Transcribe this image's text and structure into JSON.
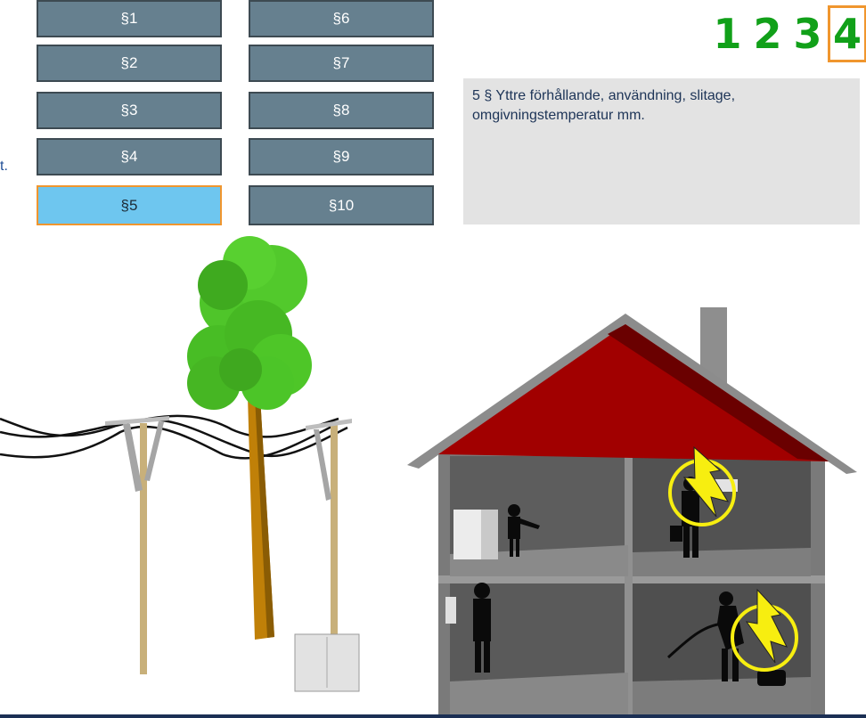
{
  "paragraph_buttons": [
    {
      "label": "§1",
      "active": false
    },
    {
      "label": "§2",
      "active": false
    },
    {
      "label": "§3",
      "active": false
    },
    {
      "label": "§4",
      "active": false
    },
    {
      "label": "§5",
      "active": true
    },
    {
      "label": "§6",
      "active": false
    },
    {
      "label": "§7",
      "active": false
    },
    {
      "label": "§8",
      "active": false
    },
    {
      "label": "§9",
      "active": false
    },
    {
      "label": "§10",
      "active": false
    }
  ],
  "left_fragment": "t.",
  "steps": [
    {
      "label": "1",
      "current": false
    },
    {
      "label": "2",
      "current": false
    },
    {
      "label": "3",
      "current": false
    },
    {
      "label": "4",
      "current": true
    }
  ],
  "description": "5 § Yttre förhållande, användning, slitage, omgivningstemperatur mm.",
  "colors": {
    "button_bg": "#66808f",
    "button_active_bg": "#6ec6ef",
    "highlight_border": "#f0962e",
    "step_green": "#11a019",
    "roof_red": "#a10000",
    "hazard_yellow": "#f7ee10"
  },
  "icons": [
    "lightning-hazard-icon",
    "lightning-hazard-icon"
  ]
}
